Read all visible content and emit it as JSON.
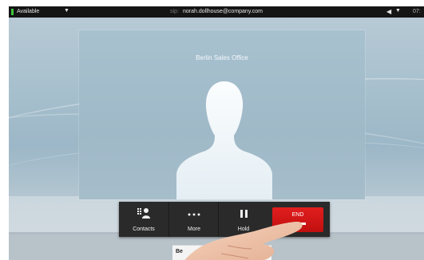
{
  "status_bar": {
    "presence": "Available",
    "presence_color": "#3ec43e",
    "user_prefix": "sip:",
    "user_email": "norah.dollhouse@company.com",
    "time": "07:"
  },
  "call": {
    "remote_name": "Berlin Sales Office"
  },
  "toolbar": {
    "contacts_label": "Contacts",
    "more_label": "More",
    "hold_label": "Hold",
    "end_label": "END",
    "end_color": "#d11616"
  },
  "bottom_card": {
    "text": "Be"
  },
  "icons": [
    "contacts-icon",
    "more-icon",
    "hold-icon",
    "speaker-icon",
    "chevron-down-icon"
  ]
}
